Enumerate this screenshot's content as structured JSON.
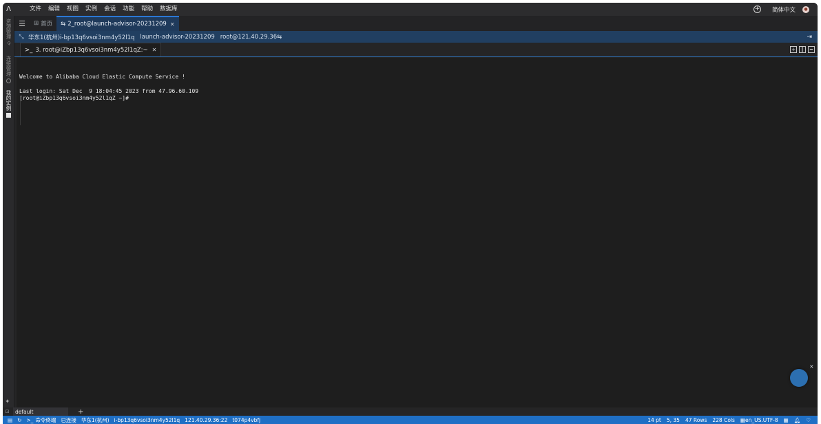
{
  "menubar": {
    "logo": "Λ",
    "menus": [
      "文件",
      "编辑",
      "视图",
      "实例",
      "会话",
      "功能",
      "帮助",
      "数据库"
    ],
    "lang": "简体中文",
    "add_icon": "+"
  },
  "sidebar": {
    "items": [
      {
        "label": "资源管理"
      },
      {
        "label": "连接管理"
      },
      {
        "label": "我的实例"
      }
    ]
  },
  "tabs": [
    {
      "label": "首页"
    },
    {
      "label": "2_root@launch-advisor-20231209"
    }
  ],
  "infobar": {
    "region": "华东1(杭州)i-bp13q6vsoi3nm4y52l1q",
    "name": "launch-advisor-20231209",
    "address": "root@121.40.29.36"
  },
  "terminal_tab": {
    "prompt_icon": ">_",
    "label": "3. root@iZbp13q6vsoi3nm4y52l1qZ:~"
  },
  "terminal": {
    "lines": [
      "",
      "Welcome to Alibaba Cloud Elastic Compute Service !",
      "",
      "Last login: Sat Dec  9 18:04:45 2023 from 47.96.60.109",
      "[root@iZbp13q6vsoi3nm4y52l1qZ ~]#"
    ]
  },
  "session": {
    "name": "default",
    "add": "+"
  },
  "statusbar": {
    "command_terminal": "命令终端",
    "connected": "已连接",
    "region": "华东1(杭州)",
    "instance": "i-bp13q6vsoi3nm4y52l1q",
    "address": "121.40.29.36:22",
    "session_id": "t074p4vbfj",
    "font_size": "14 pt",
    "cursor_pos": "5, 35",
    "rows": "47 Rows",
    "cols": "228 Cols",
    "encoding": "en_US.UTF-8"
  },
  "colors": {
    "accent": "#1f6fc5",
    "infobar": "#213f61",
    "terminal_bg": "#1e1e1e"
  }
}
